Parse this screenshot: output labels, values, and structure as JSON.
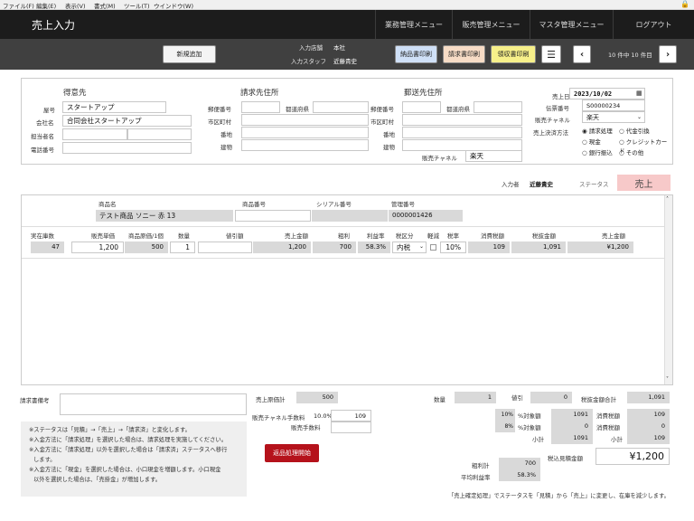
{
  "menu": {
    "file": "ファイル(F)",
    "edit": "編集(E)",
    "view": "表示(V)",
    "format": "書式(M)",
    "tools": "ツール(T)",
    "window": "ウインドウ(W)"
  },
  "header": {
    "title": "売上入力",
    "nav1": "業務管理メニュー",
    "nav2": "販売管理メニュー",
    "nav3": "マスタ管理メニュー",
    "logout": "ログアウト"
  },
  "toolbar": {
    "new": "新規追加",
    "store_label": "入力店舗",
    "store": "本社",
    "staff_label": "入力スタッフ",
    "staff": "近藤貴史",
    "delivery_print": "納品書印刷",
    "invoice_print": "請求書印刷",
    "receipt_print": "領収書印刷",
    "record_count": "10 件中 10 件目",
    "list_icon": "list-icon",
    "prev_icon": "chevron-left-icon",
    "next_icon": "chevron-right-icon"
  },
  "customer": {
    "heading": "得意先",
    "yago_label": "屋号",
    "yago": "スタートアップ",
    "company_label": "会社名",
    "company": "合同会社スタートアップ",
    "person_label": "担当者名",
    "person": "",
    "tel_label": "電話番号",
    "tel": ""
  },
  "billing": {
    "heading": "請求先住所",
    "zip_label": "郵便番号",
    "pref_label": "都道府県",
    "city_label": "市区町村",
    "street_label": "番地",
    "building_label": "建物"
  },
  "shipping": {
    "heading": "郵送先住所",
    "zip_label": "郵便番号",
    "pref_label": "都道府県",
    "city_label": "市区町村",
    "street_label": "番地",
    "building_label": "建物",
    "channel_label": "販売チャネル",
    "channel": "楽天"
  },
  "sale": {
    "date_label": "売上日",
    "date": "2023/10/02",
    "slip_label": "伝票番号",
    "slip": "S00000234",
    "channel_label": "販売チャネル",
    "channel": "楽天",
    "method_label": "売上決済方法",
    "methods": [
      "請求処理",
      "代金引換",
      "現金",
      "クレジットカード",
      "銀行振込",
      "その他"
    ],
    "entered_by_label": "入力者",
    "entered_by": "近藤貴史",
    "status_label": "ステータス",
    "status": "売上"
  },
  "item": {
    "name_label": "商品名",
    "name": "テスト商品 ソニー 赤 13",
    "code_label": "商品番号",
    "serial_label": "シリアル番号",
    "mgmt_label": "管理番号",
    "mgmt": "0000001426",
    "headers": [
      "実在庫数",
      "販売単価",
      "商品原価/1個",
      "数量",
      "値引額",
      "売上金額",
      "粗利",
      "利益率",
      "税区分",
      "軽減",
      "税率",
      "消費税額",
      "税抜金額",
      "売上金額"
    ],
    "values": {
      "stock": "47",
      "unit_price": "1,200",
      "cost": "500",
      "qty": "1",
      "discount": "",
      "amount": "1,200",
      "gross": "700",
      "margin": "58.3%",
      "tax_type": "内税",
      "rate": "10%",
      "tax": "109",
      "net": "1,091",
      "total": "¥1,200"
    }
  },
  "footer": {
    "memo_label": "請求書備考",
    "cost_total_label": "売上原価計",
    "cost_total": "500",
    "fee_rate_label": "販売チャネル手数料",
    "fee_rate": "10.0%",
    "fee_input": "109",
    "fee_label": "販売手数料",
    "return_button": "返品処理開始",
    "qty_label": "数量",
    "qty": "1",
    "discount_label": "値引",
    "discount": "0",
    "net_total_label": "税抜金額合計",
    "net_total": "1,091",
    "r10": "10%",
    "r10_label": "%対象額",
    "r10_val": "1091",
    "tax10_label": "消費税額",
    "tax10": "109",
    "r8": "8%",
    "r8_label": "%対象額",
    "r8_val": "0",
    "tax8_label": "消費税額",
    "tax8": "0",
    "subtotal_label": "小計",
    "subtotal": "1091",
    "tax_sub_label": "小計",
    "tax_sub": "109",
    "est_label": "税込見積金額",
    "est": "¥1,200",
    "gross_total_label": "粗利計",
    "gross_total": "700",
    "avg_margin_label": "平均利益率",
    "avg_margin": "58.3%",
    "notes": [
      "※ステータスは「見積」→「売上」→「請求済」と変化します。",
      "※入金方法に「請求処理」を選択した場合は、請求処理を実施してください。",
      "※入金方法に「請求処理」以外を選択した場合は「請求済」ステータスへ移行",
      "します。",
      "※入金方法に「現金」を選択した場合は、小口現金を増額します。小口現金",
      "以外を選択した場合は、「売掛金」が増加します。"
    ],
    "confirm_note": "「売上確定処理」でステータスを「見積」から「売上」に変更し、在庫を減少します。"
  }
}
